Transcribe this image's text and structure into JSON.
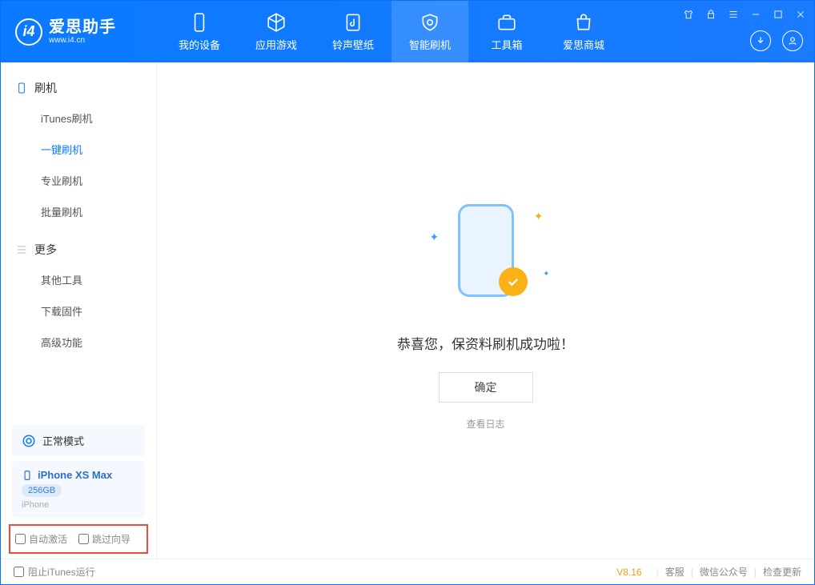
{
  "app": {
    "name": "爱思助手",
    "url": "www.i4.cn"
  },
  "nav": {
    "items": [
      {
        "label": "我的设备"
      },
      {
        "label": "应用游戏"
      },
      {
        "label": "铃声壁纸"
      },
      {
        "label": "智能刷机"
      },
      {
        "label": "工具箱"
      },
      {
        "label": "爱思商城"
      }
    ]
  },
  "sidebar": {
    "section1_title": "刷机",
    "section1_items": [
      "iTunes刷机",
      "一键刷机",
      "专业刷机",
      "批量刷机"
    ],
    "section2_title": "更多",
    "section2_items": [
      "其他工具",
      "下载固件",
      "高级功能"
    ],
    "mode_label": "正常模式",
    "device_name": "iPhone XS Max",
    "device_storage": "256GB",
    "device_type": "iPhone",
    "checkbox1": "自动激活",
    "checkbox2": "跳过向导"
  },
  "main": {
    "success_text": "恭喜您，保资料刷机成功啦！",
    "ok_button": "确定",
    "view_log": "查看日志"
  },
  "footer": {
    "block_itunes": "阻止iTunes运行",
    "version": "V8.16",
    "service": "客服",
    "wechat": "微信公众号",
    "update": "检查更新"
  }
}
